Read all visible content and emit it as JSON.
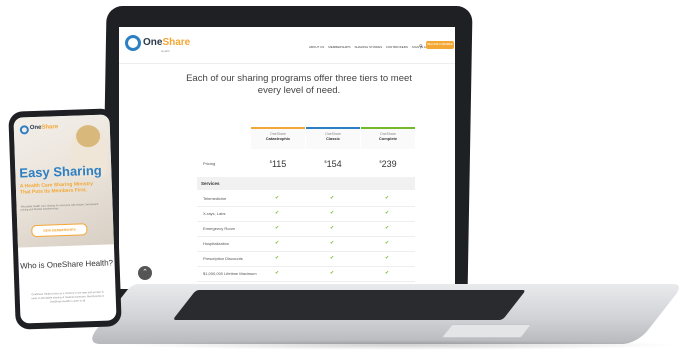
{
  "laptop_site": {
    "logo": {
      "one": "One",
      "share": "Share",
      "sub": "Health"
    },
    "nav": [
      "ABOUT US",
      "MEMBERSHIPS",
      "SHARING STORIES",
      "FOR BROKERS",
      "SIGN IN AS MEMBER"
    ],
    "cta": "BECOME A MEMBER",
    "headline": "Each of our sharing programs offer three tiers to meet every level of need.",
    "columns": [
      {
        "product": "OneShare",
        "tier": "Catastrophic",
        "color": "#f3a734",
        "price": "115"
      },
      {
        "product": "OneShare",
        "tier": "Classic",
        "color": "#2c7fc3",
        "price": "154"
      },
      {
        "product": "OneShare",
        "tier": "Complete",
        "color": "#76b82a",
        "price": "239"
      }
    ],
    "pricing_label": "Pricing",
    "services_label": "Services",
    "services": [
      {
        "name": "Telemedicine",
        "checks": [
          true,
          true,
          true
        ]
      },
      {
        "name": "X-rays, Labs",
        "checks": [
          true,
          true,
          true
        ]
      },
      {
        "name": "Emergency Room",
        "checks": [
          true,
          true,
          true
        ]
      },
      {
        "name": "Hospitalization",
        "checks": [
          true,
          true,
          true
        ]
      },
      {
        "name": "Prescription Discounts",
        "checks": [
          true,
          true,
          true
        ]
      },
      {
        "name": "$1,000,000 Lifetime Maximum",
        "checks": [
          true,
          true,
          true
        ]
      }
    ],
    "scroll_icon": "chevron-up"
  },
  "phone_site": {
    "logo": {
      "one": "One",
      "share": "Share"
    },
    "title": "Easy Sharing",
    "subtitle": "A Health Care Sharing Ministry That Puts Its Members First.",
    "small_text": "Affordable health care sharing for everyone with simple, transparent pricing and flexible memberships.",
    "button": "VIEW MEMBERSHIPS",
    "who_title": "Who is OneShare Health?",
    "body": "OneShare Health exists as a ministry to the men and women in need of affordable sharing of medical expenses. Membership in OneShare Health is open to all."
  },
  "colors": {
    "brand_blue": "#2c7fc3",
    "brand_orange": "#f3a734",
    "check_green": "#76b82a"
  }
}
